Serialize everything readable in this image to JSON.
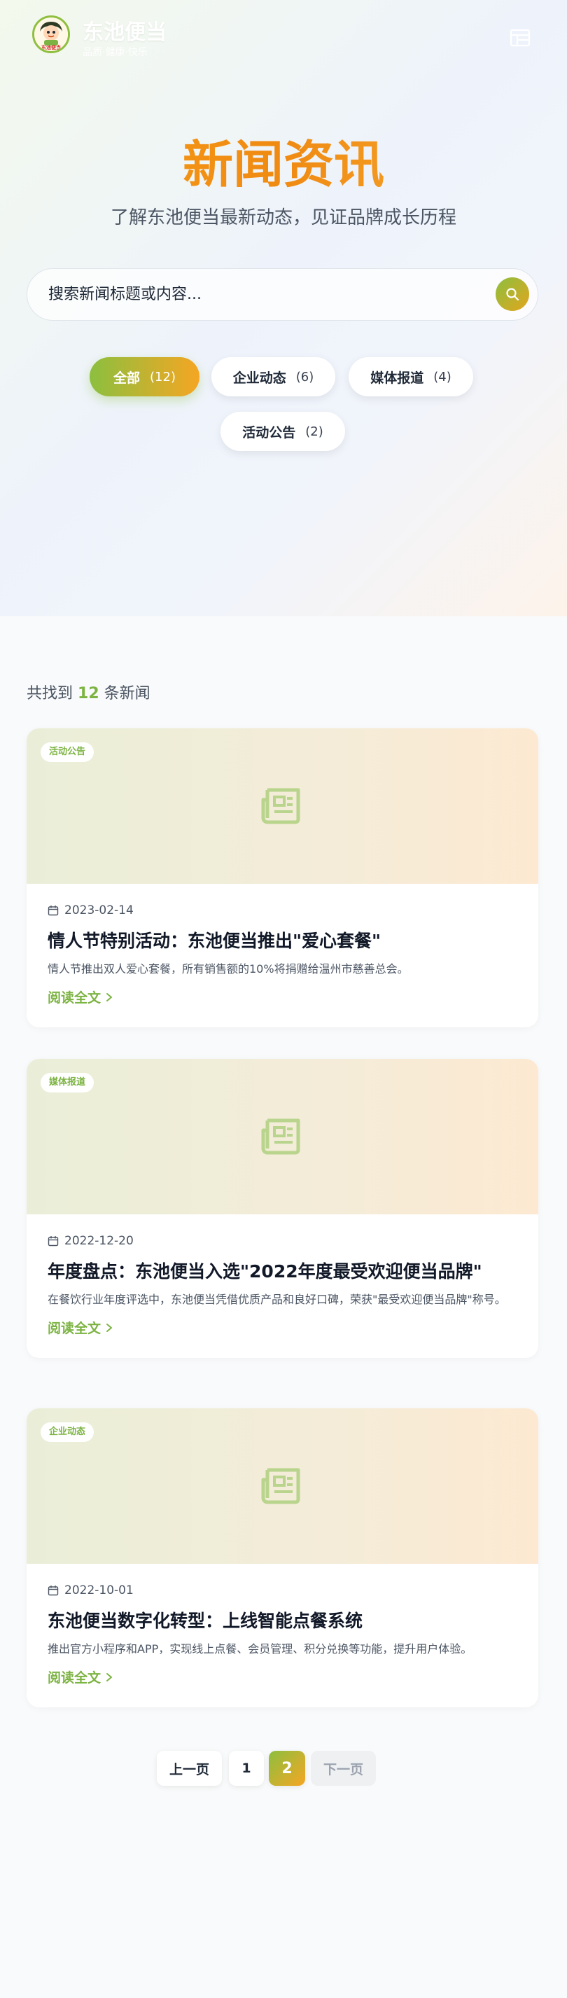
{
  "header": {
    "brand_name": "东池便当",
    "brand_slogan": "品质·健康·快乐",
    "logo_text": "东池便当",
    "menu_icon": "menu-icon"
  },
  "hero": {
    "title": "新闻资讯",
    "subtitle": "了解东池便当最新动态，见证品牌成长历程"
  },
  "search": {
    "placeholder": "搜索新闻标题或内容...",
    "value": "",
    "button_icon": "search-icon"
  },
  "filters": [
    {
      "label": "全部",
      "count": "(12)",
      "active": true
    },
    {
      "label": "企业动态",
      "count": "(6)",
      "active": false
    },
    {
      "label": "媒体报道",
      "count": "(4)",
      "active": false
    },
    {
      "label": "活动公告",
      "count": "(2)",
      "active": false
    }
  ],
  "results": {
    "prefix": "共找到",
    "count": "12",
    "suffix": "条新闻"
  },
  "articles": [
    {
      "tag": "活动公告",
      "date": "2023-02-14",
      "title": "情人节特别活动：东池便当推出\"爱心套餐\"",
      "desc": "情人节推出双人爱心套餐，所有销售额的10%将捐赠给温州市慈善总会。",
      "more": "阅读全文"
    },
    {
      "tag": "媒体报道",
      "date": "2022-12-20",
      "title": "年度盘点：东池便当入选\"2022年度最受欢迎便当品牌\"",
      "desc": "在餐饮行业年度评选中，东池便当凭借优质产品和良好口碑，荣获\"最受欢迎便当品牌\"称号。",
      "more": "阅读全文"
    },
    {
      "tag": "企业动态",
      "date": "2022-10-01",
      "title": "东池便当数字化转型：上线智能点餐系统",
      "desc": "推出官方小程序和APP，实现线上点餐、会员管理、积分兑换等功能，提升用户体验。",
      "more": "阅读全文"
    }
  ],
  "pagination": {
    "prev": "上一页",
    "pages": [
      "1",
      "2"
    ],
    "current": "2",
    "next": "下一页"
  },
  "colors": {
    "brand_green": "#7cb342",
    "brand_orange": "#f5a623",
    "title_orange": "#f08a12"
  }
}
